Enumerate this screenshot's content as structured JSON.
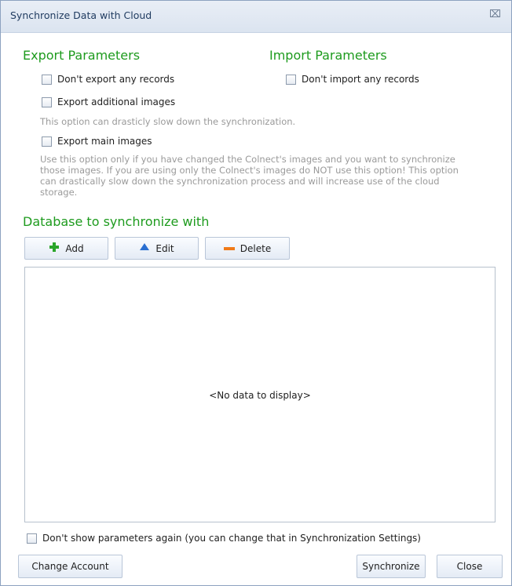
{
  "window": {
    "title": "Synchronize Data with Cloud"
  },
  "export": {
    "heading": "Export Parameters",
    "dont_export_label": "Don't export any records",
    "additional_images_label": "Export additional images",
    "additional_images_hint": "This option can drasticly slow down the synchronization.",
    "main_images_label": "Export main images",
    "main_images_hint_lines": [
      "Use this option only if you have changed the Colnect's images and you want to synchronize",
      "those images. If you are using only the Colnect's images do NOT use this option! This option",
      "can drastically slow down the synchronization process and will increase use of the cloud",
      "storage."
    ]
  },
  "import": {
    "heading": "Import Parameters",
    "dont_import_label": "Don't import any records"
  },
  "database": {
    "heading": "Database to synchronize with",
    "add_label": "Add",
    "edit_label": "Edit",
    "delete_label": "Delete",
    "empty_text": "<No data to display>"
  },
  "footer": {
    "dont_show_label": "Don't show parameters again (you can change that in Synchronization Settings)",
    "change_account_label": "Change Account",
    "synchronize_label": "Synchronize",
    "close_label": "Close"
  },
  "colors": {
    "heading": "#1e9b1e",
    "add_icon": "#2aa52a",
    "edit_icon": "#2a6fd1",
    "delete_icon": "#f07a18"
  },
  "icons": {
    "add": "plus-icon",
    "edit": "triangle-up-icon",
    "delete": "minus-icon",
    "close": "close-icon"
  }
}
